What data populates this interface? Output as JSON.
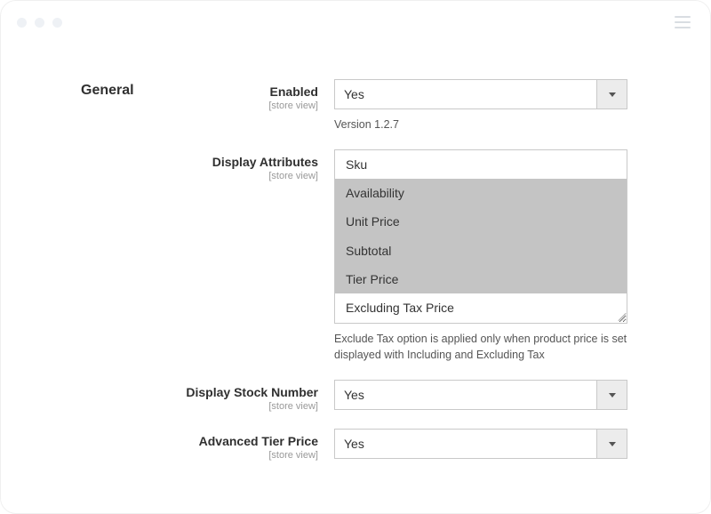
{
  "section": {
    "title": "General"
  },
  "fields": {
    "enabled": {
      "label": "Enabled",
      "scope": "[store view]",
      "value": "Yes",
      "help": "Version 1.2.7"
    },
    "display_attributes": {
      "label": "Display Attributes",
      "scope": "[store view]",
      "options": [
        {
          "text": "Sku",
          "selected": false
        },
        {
          "text": "Availability",
          "selected": true
        },
        {
          "text": "Unit Price",
          "selected": true
        },
        {
          "text": "Subtotal",
          "selected": true
        },
        {
          "text": "Tier Price",
          "selected": true
        },
        {
          "text": "Excluding Tax Price",
          "selected": false
        }
      ],
      "help": "Exclude Tax option is applied only when product price is set displayed with Including and Excluding Tax"
    },
    "display_stock_number": {
      "label": "Display Stock Number",
      "scope": "[store view]",
      "value": "Yes"
    },
    "advanced_tier_price": {
      "label": "Advanced Tier Price",
      "scope": "[store view]",
      "value": "Yes"
    }
  }
}
